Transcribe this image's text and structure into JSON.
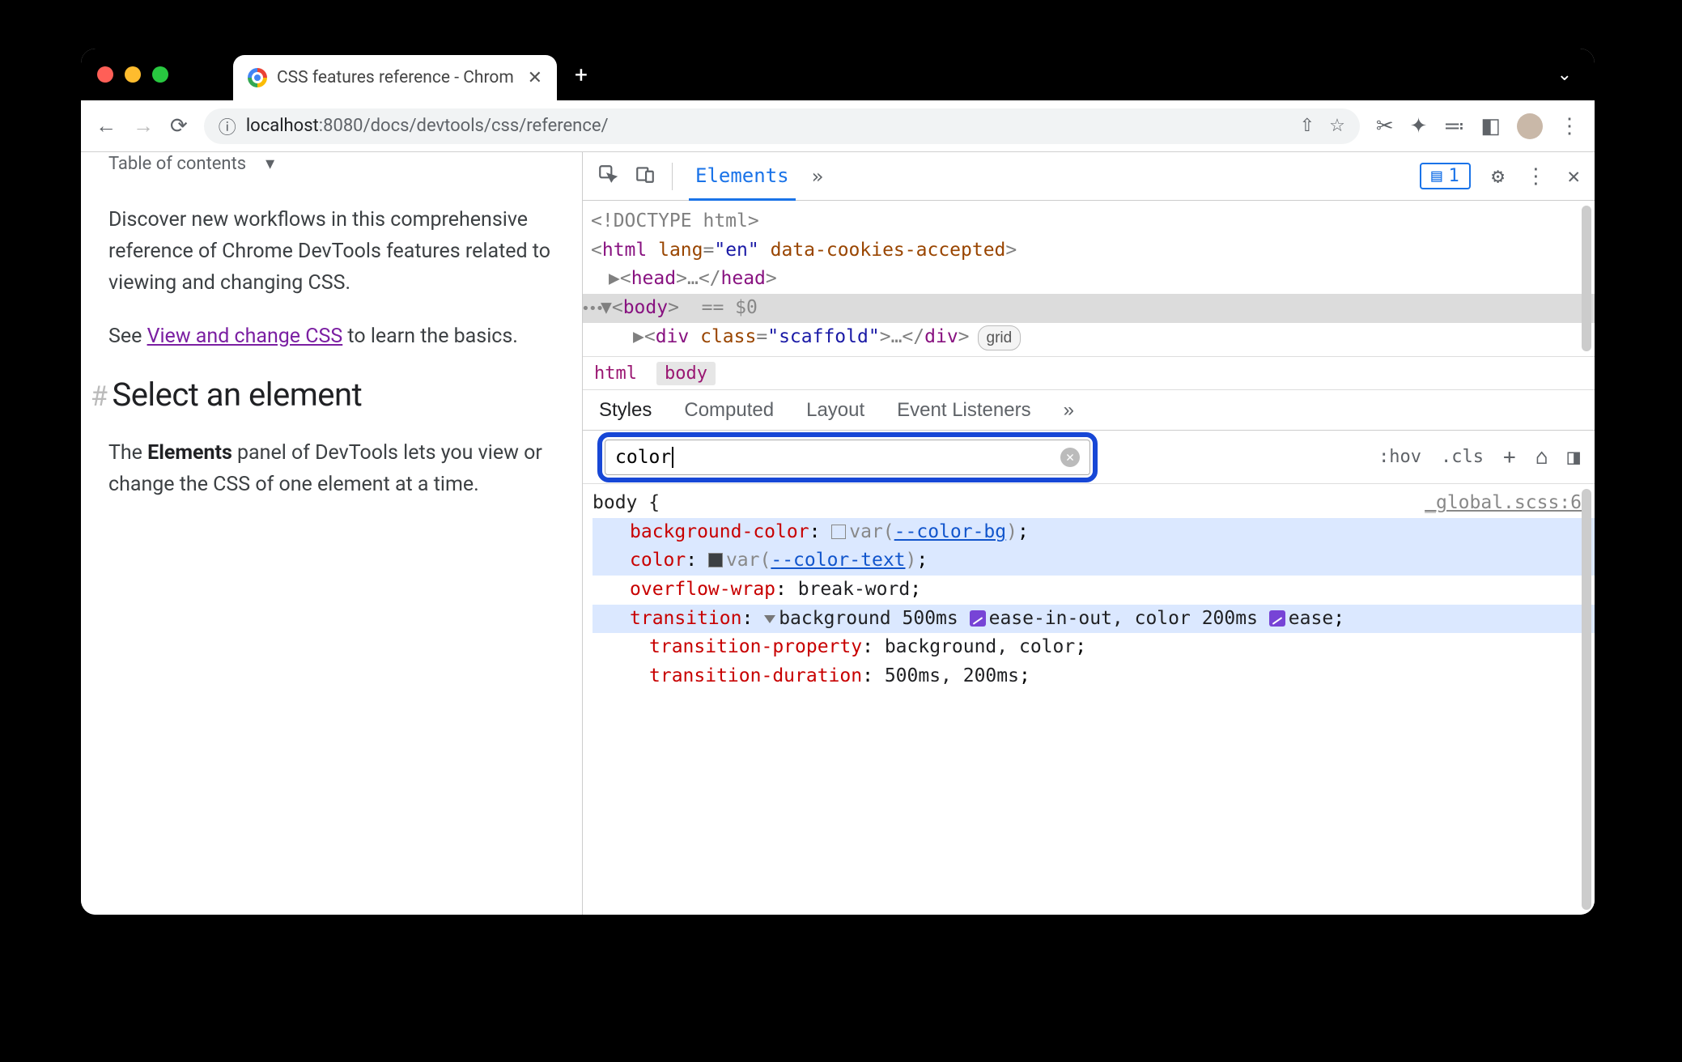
{
  "browser": {
    "tab_title": "CSS features reference - Chrom",
    "url_info": "ⓘ",
    "url_host": "localhost",
    "url_port": ":8080",
    "url_path": "/docs/devtools/css/reference/"
  },
  "page": {
    "toc": "Table of contents",
    "intro": "Discover new workflows in this comprehensive reference of Chrome DevTools features related to viewing and changing CSS.",
    "see_pre": "See ",
    "see_link": "View and change CSS",
    "see_post": " to learn the basics.",
    "h2": "Select an element",
    "para2_pre": "The ",
    "para2_strong": "Elements",
    "para2_post": " panel of DevTools lets you view or change the CSS of one element at a time."
  },
  "devtools": {
    "tabs": {
      "elements": "Elements",
      "more": "»",
      "issues_count": "1"
    },
    "dom": {
      "doctype": "<!DOCTYPE html>",
      "html_open": "html",
      "lang_attr": "lang",
      "lang_val": "\"en\"",
      "cookies_attr": "data-cookies-accepted",
      "head": "head",
      "head_ell": "…",
      "body": "body",
      "dollar": "== $0",
      "div": "div",
      "class_attr": "class",
      "class_val": "\"scaffold\"",
      "div_ell": "…",
      "badge": "grid"
    },
    "crumb": {
      "html": "html",
      "body": "body"
    },
    "subtabs": {
      "styles": "Styles",
      "computed": "Computed",
      "layout": "Layout",
      "listeners": "Event Listeners",
      "more": "»"
    },
    "filter": {
      "value": "color",
      "hov": ":hov",
      "cls": ".cls"
    },
    "styles": {
      "selector": "body {",
      "source": "_global.scss:6",
      "d1_p": "background-color",
      "d1_var": "--color-bg",
      "d2_p": "color",
      "d2_var": "--color-text",
      "d3_p": "overflow-wrap",
      "d3_v": "break-word",
      "d4_p": "transition",
      "d4_v1a": "background 500ms ",
      "d4_v1b": "ease-in-out",
      "d4_v2a": ", color 200ms ",
      "d4_v2b": "ease",
      "d5_p": "transition-property",
      "d5_v": "background, color",
      "d6_p": "transition-duration",
      "d6_v": "500ms, 200ms"
    }
  }
}
